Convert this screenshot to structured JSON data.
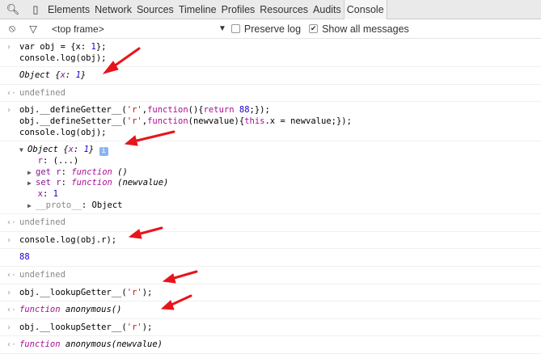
{
  "tabs": {
    "items": [
      "Elements",
      "Network",
      "Sources",
      "Timeline",
      "Profiles",
      "Resources",
      "Audits",
      "Console"
    ],
    "active": "Console"
  },
  "filter": {
    "frame": "<top frame>",
    "preserve_log": "Preserve log",
    "show_all": "Show all messages",
    "show_all_checked": true,
    "preserve_checked": false
  },
  "console": [
    {
      "type": "input",
      "lines": [
        [
          [
            "var obj = {x: ",
            ""
          ],
          [
            "1",
            "num"
          ],
          [
            "};",
            ""
          ]
        ],
        [
          [
            "console.log(obj);",
            ""
          ]
        ]
      ]
    },
    {
      "type": "log",
      "lines": [
        [
          [
            "Object {",
            "it"
          ],
          [
            "x",
            "it prop"
          ],
          [
            ": ",
            "it"
          ],
          [
            "1",
            "it num"
          ],
          [
            "}",
            "it"
          ]
        ]
      ]
    },
    {
      "type": "result",
      "lines": [
        [
          [
            "undefined",
            "gray"
          ]
        ]
      ]
    },
    {
      "type": "input",
      "lines": [
        [
          [
            "obj.__defineGetter__(",
            ""
          ],
          [
            "'r'",
            "str"
          ],
          [
            ",",
            ""
          ],
          [
            "function",
            "kw"
          ],
          [
            "(){",
            ""
          ],
          [
            "return",
            "kw"
          ],
          [
            " ",
            ""
          ],
          [
            "88",
            "num"
          ],
          [
            ";});",
            ""
          ]
        ],
        [
          [
            "obj.__defineSetter__(",
            ""
          ],
          [
            "'r'",
            "str"
          ],
          [
            ",",
            ""
          ],
          [
            "function",
            "kw"
          ],
          [
            "(newvalue){",
            ""
          ],
          [
            "this",
            "kw"
          ],
          [
            ".x = newvalue;});",
            ""
          ]
        ],
        [
          [
            "console.log(obj);",
            ""
          ]
        ]
      ]
    },
    {
      "type": "tree",
      "lines": [
        [
          [
            "▼",
            "tri"
          ],
          [
            "Object {",
            "it"
          ],
          [
            "x",
            "it prop"
          ],
          [
            ": ",
            "it"
          ],
          [
            "1",
            "it num"
          ],
          [
            "} ",
            "it"
          ],
          [
            "i",
            "info"
          ]
        ],
        [
          [
            "  ",
            ""
          ],
          [
            "r",
            "prop"
          ],
          [
            ": (...)",
            ""
          ]
        ],
        [
          [
            "▶",
            "tri"
          ],
          [
            "get r",
            "prop"
          ],
          [
            ": ",
            ""
          ],
          [
            "function",
            "it kw"
          ],
          [
            " ()",
            "it"
          ]
        ],
        [
          [
            "▶",
            "tri"
          ],
          [
            "set r",
            "prop"
          ],
          [
            ": ",
            ""
          ],
          [
            "function",
            "it kw"
          ],
          [
            " (newvalue)",
            "it"
          ]
        ],
        [
          [
            "  ",
            ""
          ],
          [
            "x",
            "prop"
          ],
          [
            ": ",
            ""
          ],
          [
            "1",
            "num"
          ]
        ],
        [
          [
            "▶",
            "tri"
          ],
          [
            "__proto__",
            "prop gray"
          ],
          [
            ": Object",
            ""
          ]
        ]
      ]
    },
    {
      "type": "result",
      "lines": [
        [
          [
            "undefined",
            "gray"
          ]
        ]
      ]
    },
    {
      "type": "input",
      "lines": [
        [
          [
            "console.log(obj.r);",
            ""
          ]
        ]
      ]
    },
    {
      "type": "log",
      "lines": [
        [
          [
            "88",
            "num"
          ]
        ]
      ]
    },
    {
      "type": "result",
      "lines": [
        [
          [
            "undefined",
            "gray"
          ]
        ]
      ]
    },
    {
      "type": "input",
      "lines": [
        [
          [
            "obj.__lookupGetter__(",
            ""
          ],
          [
            "'r'",
            "str"
          ],
          [
            ");",
            ""
          ]
        ]
      ]
    },
    {
      "type": "result",
      "lines": [
        [
          [
            "function",
            "it kw"
          ],
          [
            " anonymous()",
            "it"
          ]
        ]
      ]
    },
    {
      "type": "input",
      "lines": [
        [
          [
            "obj.__lookupSetter__(",
            ""
          ],
          [
            "'r'",
            "str"
          ],
          [
            ");",
            ""
          ]
        ]
      ]
    },
    {
      "type": "result",
      "lines": [
        [
          [
            "function",
            "it kw"
          ],
          [
            " anonymous(newvalue)",
            "it"
          ]
        ]
      ]
    }
  ],
  "colors": {
    "arrow": "#e8141b"
  }
}
